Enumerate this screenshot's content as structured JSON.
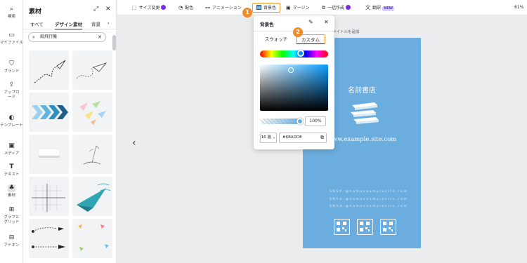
{
  "rail": [
    {
      "id": "search",
      "label": "検索",
      "icon": "search-icon"
    },
    {
      "id": "my-files",
      "label": "マイファイル",
      "icon": "folder-icon"
    },
    {
      "id": "brand",
      "label": "ブランド",
      "icon": "brand-icon"
    },
    {
      "id": "upload",
      "label": "アップロード",
      "icon": "upload-icon"
    },
    {
      "id": "template",
      "label": "テンプレート",
      "icon": "template-icon"
    },
    {
      "id": "media",
      "label": "メディア",
      "icon": "media-icon"
    },
    {
      "id": "text",
      "label": "テキスト",
      "icon": "text-icon"
    },
    {
      "id": "elements",
      "label": "素材",
      "icon": "elements-icon"
    },
    {
      "id": "graph-grid",
      "label": "グラフとグリッド",
      "icon": "grid-icon"
    },
    {
      "id": "addon",
      "label": "アドオン",
      "icon": "addon-icon"
    }
  ],
  "panel": {
    "title": "素材",
    "tabs": [
      "すべて",
      "デザイン素材",
      "背景"
    ],
    "active_tab": "デザイン素材",
    "search_value": "紙飛行機"
  },
  "toolbar": {
    "resize": "サイズ変更",
    "color": "配色",
    "animation": "アニメーション",
    "bg_color": "背景色",
    "margin": "マージン",
    "bulk": "一括作成",
    "translate": "翻訳",
    "new_badge": "NEW",
    "zoom": "61%"
  },
  "steps": {
    "one": "1",
    "two": "2"
  },
  "popover": {
    "title": "背景色",
    "tab_swatch": "スウォッチ",
    "tab_custom": "カスタム",
    "opacity": "100%",
    "format": "16 進 ⌄",
    "hex": "#6BADDE"
  },
  "canvas": {
    "hint": "タイトルを追加",
    "title": "名前書店",
    "url": "www.example.site.com",
    "sns": [
      "S N S ① : @ n a m e e x a m p l e s i t e . c o m",
      "S N S ② : @ n a m e e x a m p l e s i t e . c o m",
      "S N S ③ : @ n a m e e x a m p l e s i t e . c o m"
    ]
  },
  "colors": {
    "accent": "#f29a2e",
    "card": "#6badde",
    "selected_hex": "#6BADDE"
  }
}
